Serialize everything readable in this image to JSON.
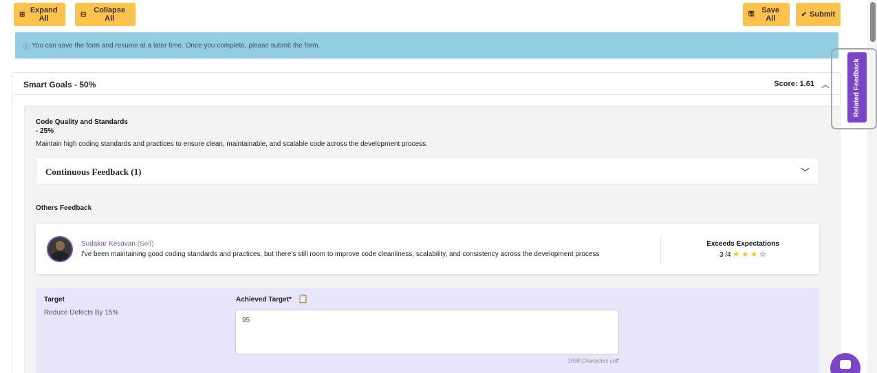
{
  "toolbar": {
    "expand_all": "Expand All",
    "collapse_all": "Collapse All",
    "save_all": "Save All",
    "submit": "Submit"
  },
  "alert": {
    "text": "You can save the form and resume at a later time. Once you complete, please submit the form."
  },
  "section": {
    "title": "Smart Goals - 50%",
    "score": "Score: 1.61"
  },
  "goal": {
    "title_line1": "Code Quality and Standards",
    "title_line2": "- 25%",
    "description": "Maintain high coding standards and practices to ensure clean, maintainable, and scalable code across the development process."
  },
  "continuous_feedback": {
    "title": "Continuous Feedback (1)"
  },
  "others_feedback": {
    "label": "Others Feedback",
    "items": [
      {
        "name": "Sudakar Kesavan",
        "role": "(Self)",
        "text": "I've been maintaining good coding standards and practices, but there's still room to improve code cleanliness, scalability, and consistency across the development process",
        "rating_label": "Exceeds Expectations",
        "rating_text": "3 /4",
        "rating": 3,
        "rating_max": 4
      }
    ]
  },
  "target": {
    "label": "Target",
    "value": "Reduce Defects By 15%",
    "achieved_label": "Achieved Target*",
    "achieved_value": "95",
    "chars_left": "1998 Characters Left"
  },
  "side_tab": {
    "label": "Related Feedback"
  },
  "colors": {
    "accent_yellow": "#fbc34d",
    "info_blue": "#93cde3",
    "purple": "#7a45c8",
    "target_bg": "#e6e5fa"
  }
}
